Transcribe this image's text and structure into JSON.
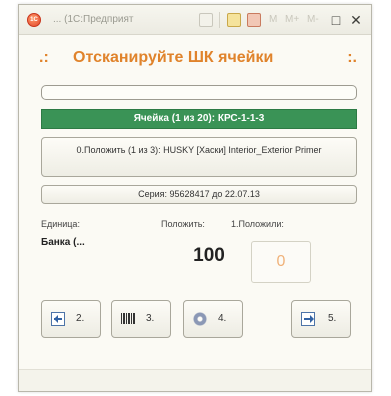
{
  "window": {
    "title": "... (1С:Предприят",
    "menu_m": [
      "M",
      "M+",
      "M-"
    ],
    "restore_glyph": "□",
    "close_glyph": "✕"
  },
  "heading": {
    "left_decor": ".:",
    "title": "Отсканируйте ШК ячейки",
    "right_decor": ":."
  },
  "progress": {
    "value": 0
  },
  "cell": {
    "label": "Ячейка (1 из 20): КРС-1-1-3"
  },
  "place": {
    "label": "0.Положить (1 из 3): HUSKY [Хаски] Interior_Exterior Primer"
  },
  "series": {
    "label": "Серия: 95628417 до 22.07.13"
  },
  "fields": {
    "unit_label": "Единица:",
    "put_label": "Положить:",
    "placed_label": "1.Положили:",
    "unit_value": "Банка (...",
    "put_value": "100",
    "placed_value": "0"
  },
  "actions": [
    {
      "num": "2.",
      "icon": "back-arrow-icon"
    },
    {
      "num": "3.",
      "icon": "barcode-icon"
    },
    {
      "num": "4.",
      "icon": "gear-icon"
    },
    {
      "num": "5.",
      "icon": "forward-arrow-icon"
    }
  ],
  "colors": {
    "accent": "#e0832b",
    "cell_bar": "#3a9356",
    "placed_value": "#f0b27a"
  }
}
